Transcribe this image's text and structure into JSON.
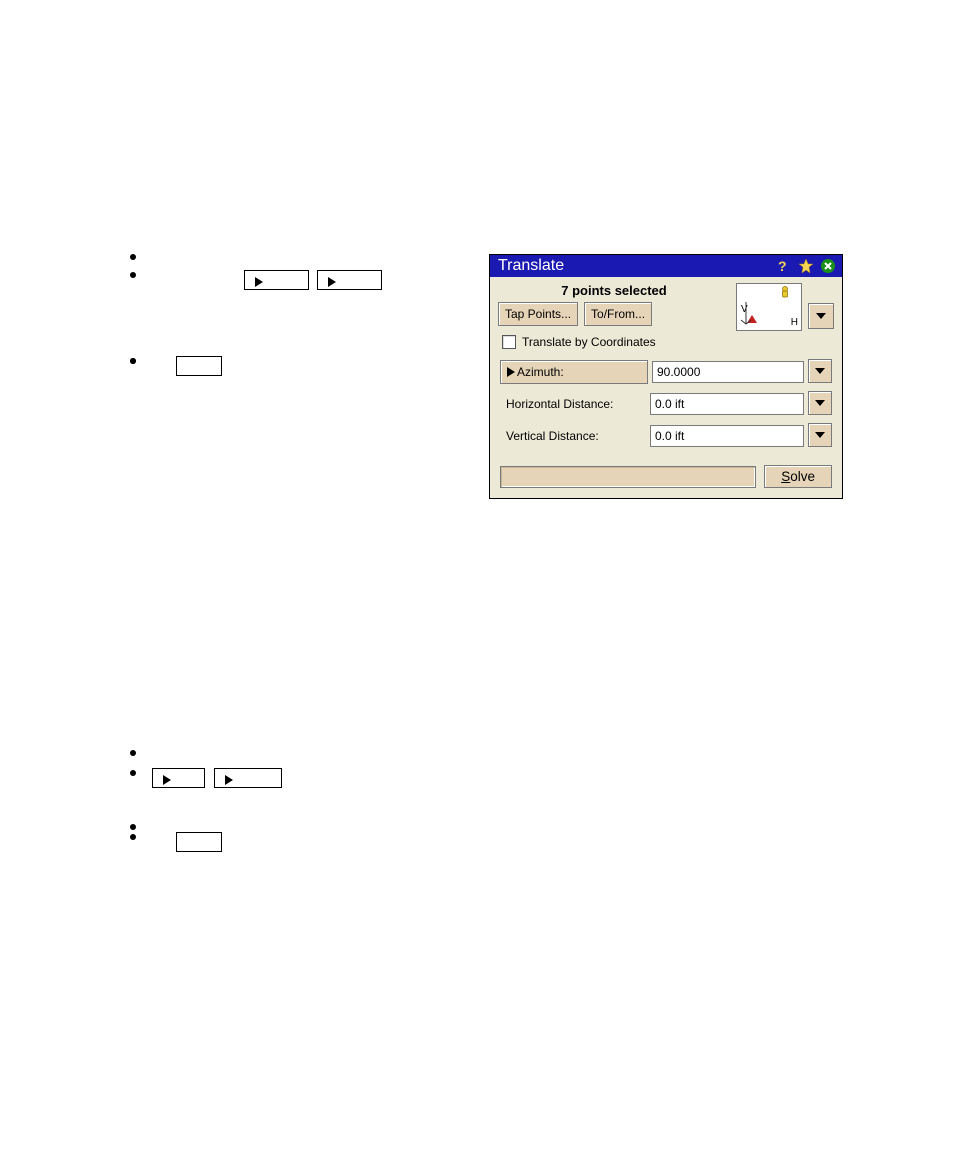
{
  "dialog": {
    "title": "Translate",
    "points_selected": "7 points selected",
    "btn_tap_points": "Tap Points...",
    "btn_to_from": "To/From...",
    "chk_translate_by_coords": "Translate by Coordinates",
    "fields": {
      "azimuth": {
        "label": "Azimuth:",
        "value": "90.0000"
      },
      "horizontal": {
        "label": "Horizontal Distance:",
        "value": "0.0 ift"
      },
      "vertical": {
        "label": "Vertical Distance:",
        "value": "0.0 ift"
      }
    },
    "preview": {
      "v": "V",
      "h": "H"
    },
    "solve": "Solve"
  }
}
